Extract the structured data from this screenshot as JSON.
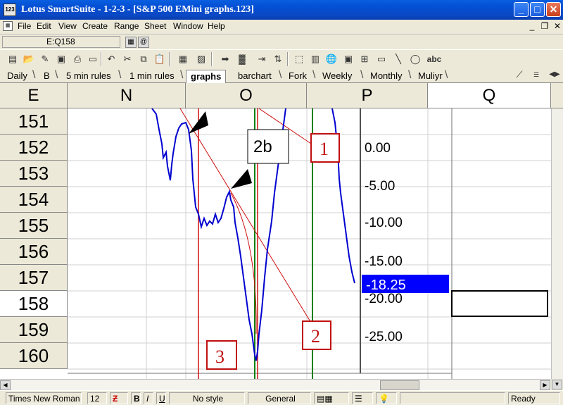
{
  "window": {
    "title": "Lotus SmartSuite  -  1-2-3 - [S&P 500 EMini graphs.123]",
    "app_icon_text": "123"
  },
  "menu": [
    "File",
    "Edit",
    "View",
    "Create",
    "Range",
    "Sheet",
    "Window",
    "Help"
  ],
  "refbar": {
    "cell_ref": "E:Q158"
  },
  "tabs": [
    {
      "label": "Daily",
      "active": false
    },
    {
      "label": "B",
      "active": false
    },
    {
      "label": "5 min rules",
      "active": false
    },
    {
      "label": "1 min rules",
      "active": false
    },
    {
      "label": "graphs",
      "active": true
    },
    {
      "label": "barchart",
      "active": false
    },
    {
      "label": "Fork",
      "active": false
    },
    {
      "label": "Weekly",
      "active": false
    },
    {
      "label": "Monthly",
      "active": false
    },
    {
      "label": "Muliyr",
      "active": false
    }
  ],
  "columns": [
    "E",
    "N",
    "O",
    "P",
    "Q"
  ],
  "rows": [
    "151",
    "152",
    "153",
    "154",
    "155",
    "156",
    "157",
    "158",
    "159",
    "160"
  ],
  "active_row": "158",
  "chart_data": {
    "type": "line",
    "y_ticks": [
      "0.00",
      "-5.00",
      "-10.00",
      "-15.00",
      "-20.00",
      "-25.00"
    ],
    "current_value": "-18.25",
    "annotations": [
      "1",
      "2",
      "2b",
      "3"
    ],
    "line_color": "#0000d0",
    "highlight_color": "#0000ff"
  },
  "status": {
    "font": "Times New Roman",
    "size": "12",
    "bold": "B",
    "italic": "I",
    "underline": "U",
    "style": "No style",
    "format": "General",
    "mode": "Ready"
  },
  "toolbar_icons": [
    "open-icon",
    "save-icon",
    "print-icon",
    "undo-icon",
    "cut-icon",
    "copy-icon",
    "paste-icon",
    "chart-icon",
    "arrow-icon",
    "abc-icon"
  ]
}
